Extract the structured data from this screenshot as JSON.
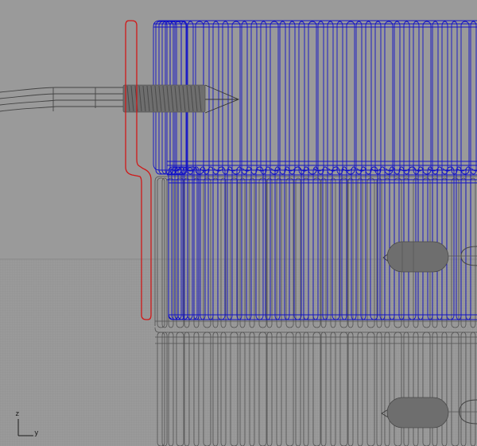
{
  "viewport": {
    "background_color": "#9a9a9a",
    "grid_color": "#8e8e8e",
    "grid_major_color": "#868686"
  },
  "axes": {
    "vertical_label": "z",
    "horizontal_label": "y"
  },
  "objects": {
    "selected_wire_color": "#1010c8",
    "unselected_wire_color": "#505050",
    "highlight_color": "#d01818",
    "solid_shade_color": "#6e6e6e",
    "icons": [
      "cable-wire-icon",
      "screw-thread-icon",
      "screw-tip-icon",
      "capsule-handle-icon",
      "clip-curve-icon",
      "ring-bracket-icon"
    ]
  }
}
